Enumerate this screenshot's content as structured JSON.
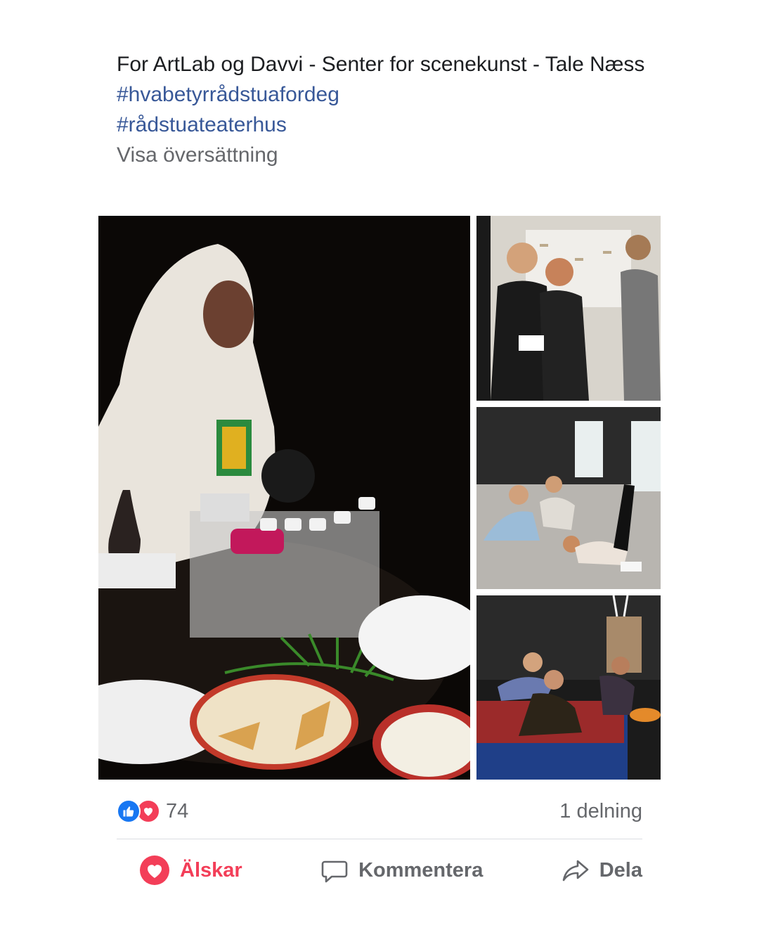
{
  "post": {
    "text": "For ArtLab og Davvi - Senter for scenekunst - Tale Næss",
    "hashtags": [
      "#hvabetyrrådstuafordeg",
      "#rådstuateaterhus"
    ],
    "translate_label": "Visa översättning"
  },
  "photos": [
    {
      "description": "woman-coffee-ceremony"
    },
    {
      "description": "actors-rehearsing"
    },
    {
      "description": "dancers-on-floor"
    },
    {
      "description": "actors-on-mattress"
    }
  ],
  "stats": {
    "reaction_count": "74",
    "shares_label": "1 delning"
  },
  "actions": {
    "love_label": "Älskar",
    "comment_label": "Kommentera",
    "share_label": "Dela"
  },
  "colors": {
    "link": "#385898",
    "secondary_text": "#65676b",
    "love": "#f33e58",
    "like": "#1877f2"
  }
}
